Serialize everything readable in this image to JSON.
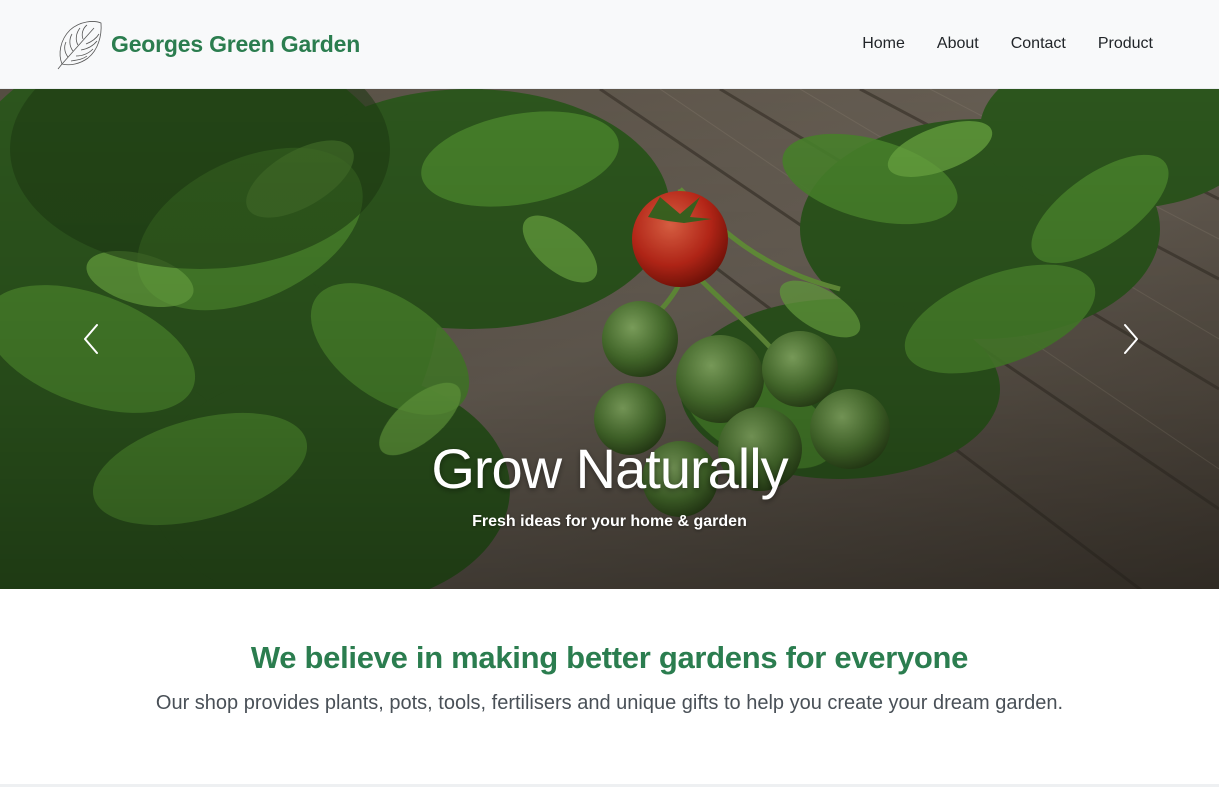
{
  "header": {
    "brand_name": "Georges Green Garden",
    "logo_icon": "monstera-leaf-icon",
    "nav": [
      {
        "label": "Home"
      },
      {
        "label": "About"
      },
      {
        "label": "Contact"
      },
      {
        "label": "Product"
      }
    ]
  },
  "hero": {
    "title": "Grow Naturally",
    "subtitle": "Fresh ideas for your home & garden",
    "prev_icon": "chevron-left-icon",
    "next_icon": "chevron-right-icon"
  },
  "intro": {
    "heading": "We believe in making better gardens for everyone",
    "text": "Our shop provides plants, pots, tools, fertilisers and unique gifts to help you create your dream garden."
  },
  "colors": {
    "brand_green": "#2b7d4f",
    "navbar_bg": "#f8f9fa",
    "body_text": "#495057"
  }
}
